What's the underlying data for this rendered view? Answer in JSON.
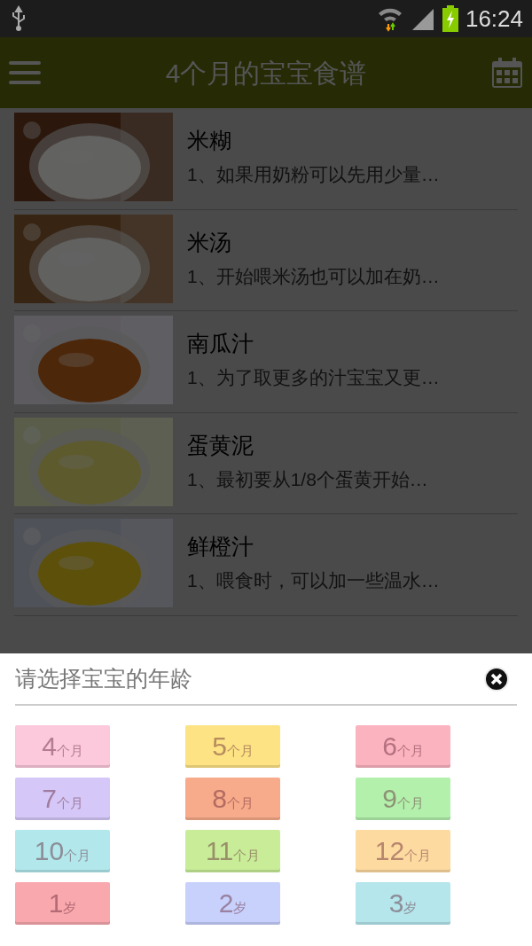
{
  "status_bar": {
    "time": "16:24"
  },
  "app_bar": {
    "title": "4个月的宝宝食谱"
  },
  "recipes": [
    {
      "title": "米糊",
      "summary": "1、如果用奶粉可以先用少量…"
    },
    {
      "title": "米汤",
      "summary": "1、开始喂米汤也可以加在奶…"
    },
    {
      "title": "南瓜汁",
      "summary": "1、为了取更多的汁宝宝又更…"
    },
    {
      "title": "蛋黄泥",
      "summary": "1、最初要从1/8个蛋黄开始…"
    },
    {
      "title": "鲜橙汁",
      "summary": "1、喂食时，可以加一些温水…"
    }
  ],
  "age_sheet": {
    "title": "请选择宝宝的年龄",
    "ages": [
      {
        "number": "4",
        "unit": "个月",
        "color": "#fbc8dc"
      },
      {
        "number": "5",
        "unit": "个月",
        "color": "#fde384"
      },
      {
        "number": "6",
        "unit": "个月",
        "color": "#fbb3c0"
      },
      {
        "number": "7",
        "unit": "个月",
        "color": "#d5c8f8"
      },
      {
        "number": "8",
        "unit": "个月",
        "color": "#f7ab8a"
      },
      {
        "number": "9",
        "unit": "个月",
        "color": "#b2f0ac"
      },
      {
        "number": "10",
        "unit": "个月",
        "color": "#b2e8ec"
      },
      {
        "number": "11",
        "unit": "个月",
        "color": "#c8ec98"
      },
      {
        "number": "12",
        "unit": "个月",
        "color": "#fddaa0"
      },
      {
        "number": "1",
        "unit": "岁",
        "color": "#f9a8ae"
      },
      {
        "number": "2",
        "unit": "岁",
        "color": "#c8d0fc"
      },
      {
        "number": "3",
        "unit": "岁",
        "color": "#b4e6ec"
      }
    ]
  }
}
